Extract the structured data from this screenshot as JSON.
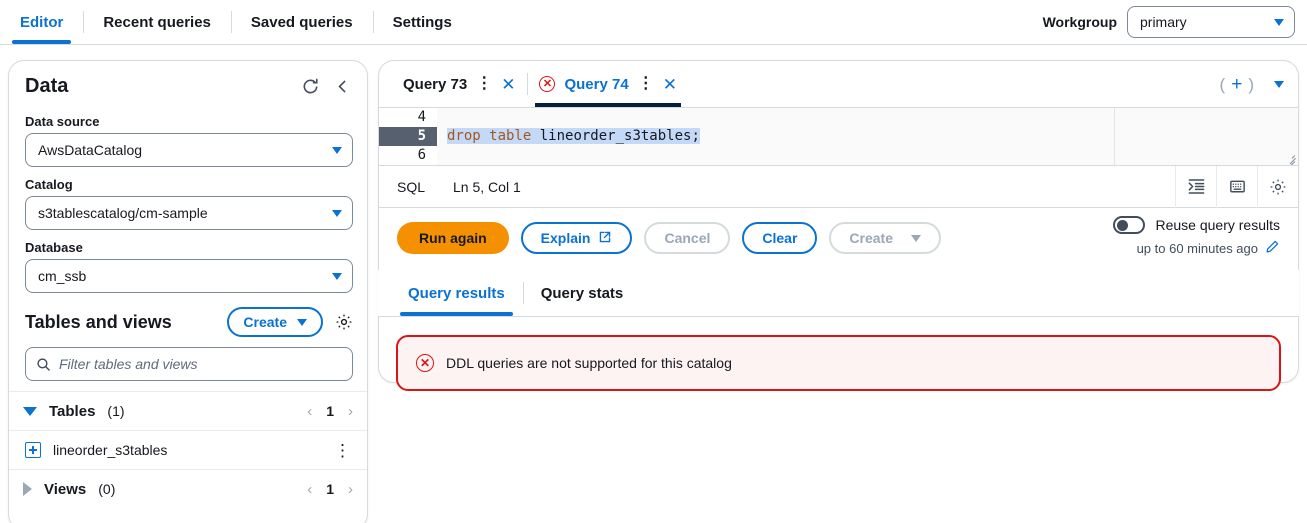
{
  "topnav": {
    "tabs": [
      {
        "label": "Editor",
        "active": true
      },
      {
        "label": "Recent queries",
        "active": false
      },
      {
        "label": "Saved queries",
        "active": false
      },
      {
        "label": "Settings",
        "active": false
      }
    ],
    "workgroup_label": "Workgroup",
    "workgroup_value": "primary"
  },
  "sidebar": {
    "title": "Data",
    "refresh_icon": "refresh-icon",
    "collapse_icon": "chevron-left-icon",
    "data_source_label": "Data source",
    "data_source_value": "AwsDataCatalog",
    "catalog_label": "Catalog",
    "catalog_value": "s3tablescatalog/cm-sample",
    "database_label": "Database",
    "database_value": "cm_ssb",
    "tables_views_title": "Tables and views",
    "create_label": "Create",
    "settings_icon": "gear-icon",
    "filter_placeholder": "Filter tables and views",
    "search_icon": "search-icon",
    "tables_group": {
      "label": "Tables",
      "count": "(1)",
      "page": "1"
    },
    "tables": [
      {
        "name": "lineorder_s3tables"
      }
    ],
    "views_group": {
      "label": "Views",
      "count": "(0)",
      "page": "1"
    }
  },
  "editor_panel": {
    "query_tabs": [
      {
        "label": "Query 73",
        "active": false,
        "has_error": false
      },
      {
        "label": "Query 74",
        "active": true,
        "has_error": true
      }
    ],
    "new_tab_icon": "plus-icon",
    "tabs_menu_icon": "chevron-down-icon",
    "code_lines": [
      {
        "number": "4",
        "text": "",
        "active": false
      },
      {
        "number": "5",
        "keyword": "drop table",
        "rest": " lineorder_s3tables;",
        "active": true
      },
      {
        "number": "6",
        "text": "",
        "active": false
      }
    ],
    "status_language": "SQL",
    "status_position": "Ln 5, Col 1",
    "status_icons": [
      "format-indent-icon",
      "keyboard-icon",
      "gear-icon"
    ],
    "buttons": {
      "run": "Run again",
      "explain": "Explain",
      "explain_icon": "external-link-icon",
      "cancel": "Cancel",
      "clear": "Clear",
      "create": "Create"
    },
    "reuse": {
      "label": "Reuse query results",
      "sub": "up to 60 minutes ago",
      "edit_icon": "pencil-icon",
      "enabled": false
    }
  },
  "results_panel": {
    "tabs": [
      {
        "label": "Query results",
        "active": true
      },
      {
        "label": "Query stats",
        "active": false
      }
    ],
    "error_icon": "error-circle-icon",
    "error_message": "DDL queries are not supported for this catalog"
  },
  "colors": {
    "accent_blue": "#0972d3",
    "orange": "#f59100",
    "error_red": "#d91515",
    "error_bg": "#fdf3f3"
  }
}
